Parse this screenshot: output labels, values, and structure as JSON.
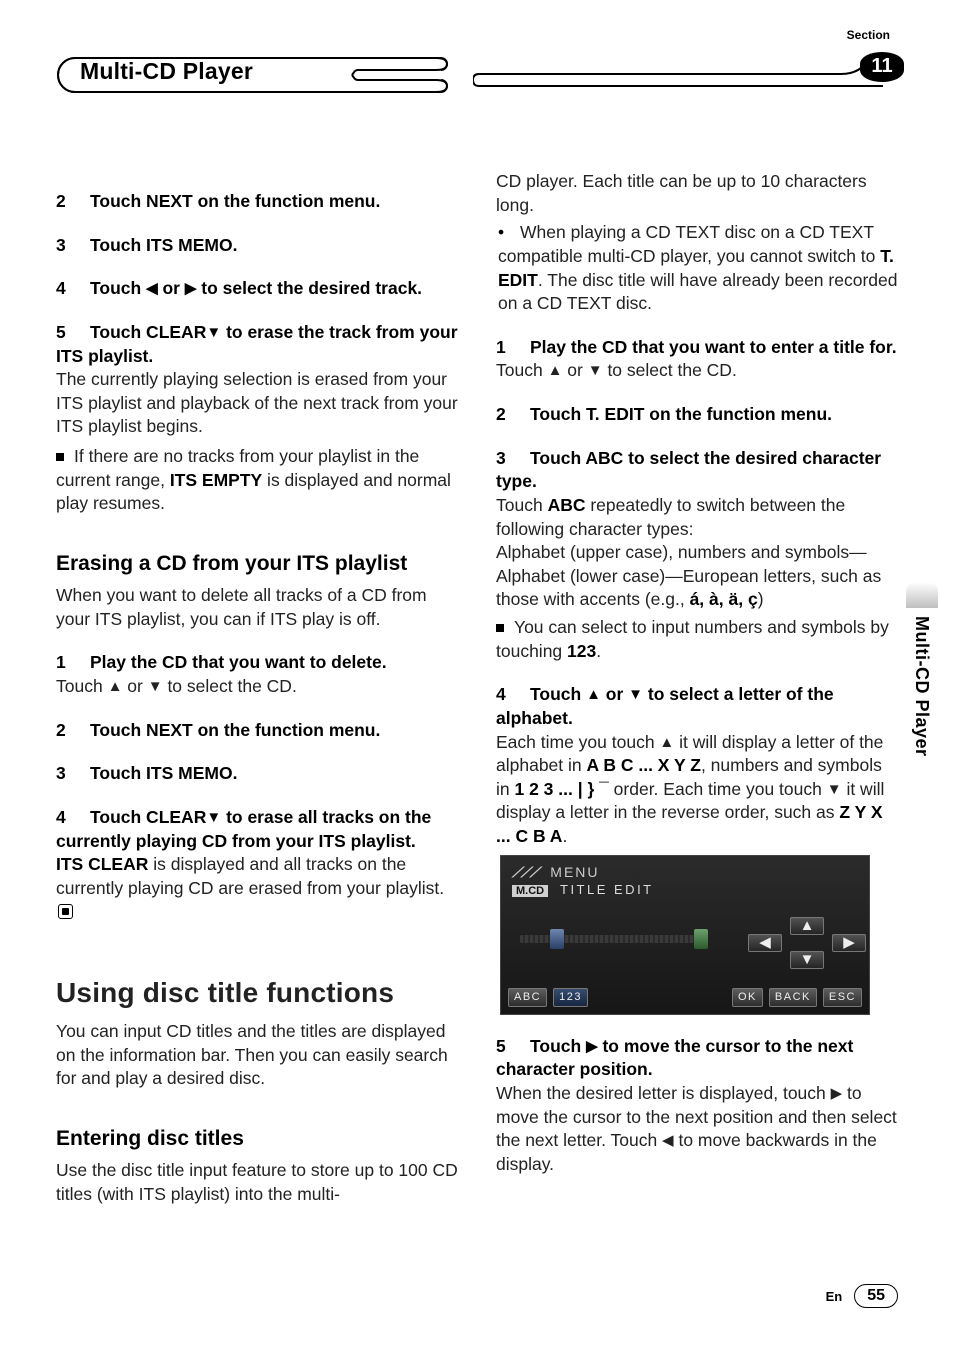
{
  "header": {
    "title": "Multi-CD Player",
    "section_label": "Section",
    "section_number": "11"
  },
  "side_tab": "Multi-CD Player",
  "footer": {
    "lang": "En",
    "page": "55"
  },
  "left": {
    "s2": "Touch NEXT on the function menu.",
    "s3": "Touch ITS MEMO.",
    "s4a": "Touch ",
    "s4b": " or ",
    "s4c": " to select the desired track.",
    "s5a": "Touch CLEAR",
    "s5b": " to erase the track from your ITS playlist.",
    "s5_body": "The currently playing selection is erased from your ITS playlist and playback of the next track from your ITS playlist begins.",
    "s5_note_a": "If there are no tracks from your playlist in the current range, ",
    "s5_note_b": "ITS EMPTY",
    "s5_note_c": " is displayed and normal play resumes.",
    "h_erase": "Erasing a CD from your ITS playlist",
    "erase_intro": "When you want to delete all tracks of a CD from your ITS playlist, you can if ITS play is off.",
    "e1": "Play the CD that you want to delete.",
    "e1_body_a": "Touch ",
    "e1_body_b": " or ",
    "e1_body_c": " to select the CD.",
    "e2": "Touch NEXT on the function menu.",
    "e3": "Touch ITS MEMO.",
    "e4a": "Touch CLEAR",
    "e4b": " to erase all tracks on the currently playing CD from your ITS playlist.",
    "e4_body_a": "ITS CLEAR",
    "e4_body_b": " is displayed and all tracks on the currently playing CD are erased from your playlist.",
    "h_using": "Using disc title functions",
    "using_intro": "You can input CD titles and the titles are displayed on the information bar. Then you can easily search for and play a desired disc.",
    "h_enter": "Entering disc titles",
    "enter_intro": "Use the disc title input feature to store up to 100 CD titles  (with ITS playlist) into the multi-"
  },
  "right": {
    "cont": "CD player. Each title can be up to 10 characters long.",
    "bul_a": "When playing a CD TEXT disc on a CD TEXT compatible multi-CD player, you cannot switch to ",
    "bul_b": "T. EDIT",
    "bul_c": ". The disc title will have already been recorded on a CD TEXT disc.",
    "r1": "Play the CD that you want to enter a title for.",
    "r1_body_a": "Touch ",
    "r1_body_b": " or ",
    "r1_body_c": " to select the CD.",
    "r2": "Touch T. EDIT on the function menu.",
    "r3": "Touch ABC to select the desired character type.",
    "r3_body_a": "Touch ",
    "r3_body_abc": "ABC",
    "r3_body_b": " repeatedly to switch between the following character types:",
    "r3_body_c": "Alphabet (upper case), numbers and symbols—Alphabet (lower case)—European letters, such as those with accents (e.g., ",
    "r3_body_acc": "á, à, ä, ç",
    "r3_body_d": ")",
    "r3_note_a": "You can select to input numbers and symbols by touching ",
    "r3_note_b": "123",
    "r3_note_c": ".",
    "r4a": "Touch ",
    "r4b": " or ",
    "r4c": " to select a letter of the alphabet.",
    "r4_body_a": "Each time you touch ",
    "r4_body_b": " it will display a letter of the alphabet in ",
    "r4_body_c": "A B C ... X Y Z",
    "r4_body_d": ", numbers and symbols in ",
    "r4_body_e": "1 2 3 ... | } ¯",
    "r4_body_f": " order. Each time you touch ",
    "r4_body_g": " it will display a letter in the reverse order, such as ",
    "r4_body_h": "Z Y X ... C B A",
    "r4_body_i": ".",
    "ui": {
      "menu": "MENU",
      "mcd": "M.CD",
      "title": "TITLE EDIT",
      "abc": "ABC",
      "n123": "123",
      "ok": "OK",
      "back": "BACK",
      "esc": "ESC"
    },
    "r5a": "Touch ",
    "r5b": " to move the cursor to the next character position.",
    "r5_body_a": "When the desired letter is displayed, touch ",
    "r5_body_b": " to move the cursor to the next position and then select the next letter. Touch ",
    "r5_body_c": " to move backwards in the display."
  },
  "glyph": {
    "left": "◀",
    "right": "▶",
    "up": "▲",
    "down": "▼"
  }
}
